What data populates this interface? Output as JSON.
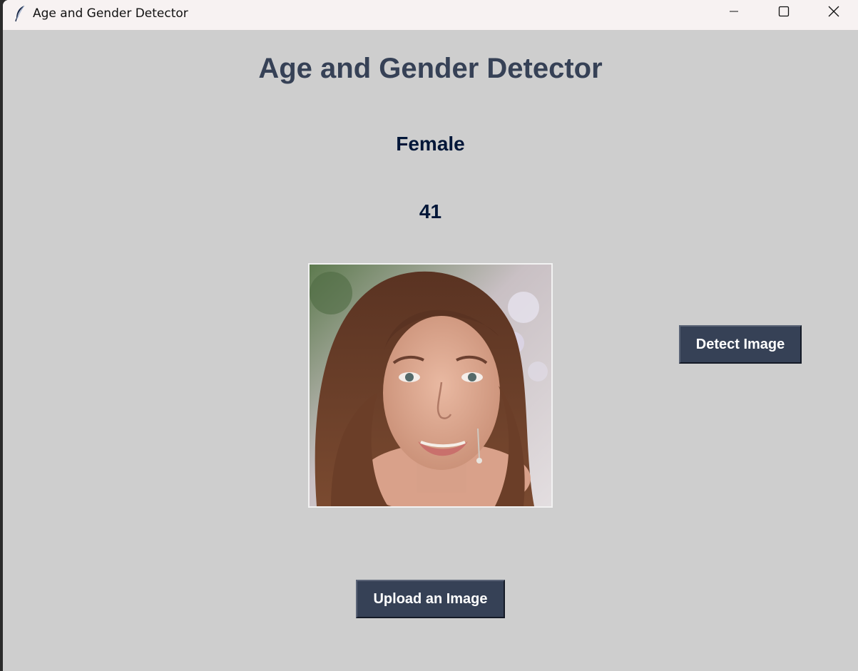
{
  "window": {
    "title": "Age and Gender Detector",
    "icon": "feather-icon",
    "controls": [
      "minimize-icon",
      "maximize-icon",
      "close-icon"
    ]
  },
  "main": {
    "heading": "Age and Gender Detector",
    "gender_label": "Female",
    "age_label": "41",
    "detect_button_label": "Detect Image",
    "upload_button_label": "Upload an Image"
  },
  "colors": {
    "background": "#cecece",
    "heading": "#364156",
    "result_text": "#011638",
    "button_bg": "#364156",
    "button_text": "#ffffff"
  }
}
